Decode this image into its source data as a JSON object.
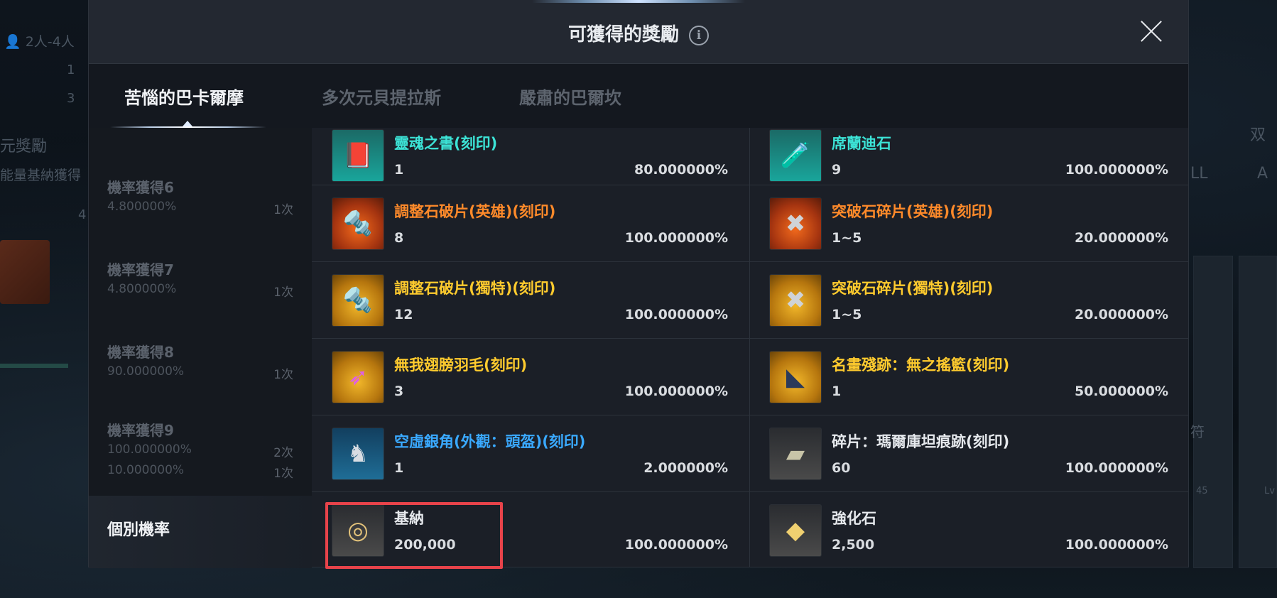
{
  "background": {
    "party_size": "2人-4人",
    "rewards_title": "元獎勵",
    "gain_text": "能量基納獲得",
    "count_a": "1",
    "count_b": "3",
    "count_c": "4",
    "right_text": "双",
    "right_char_a": "LL",
    "right_char_b": "A",
    "right_char_c": "符",
    "level_a": "45",
    "level_b": "Lv"
  },
  "modal": {
    "title": "可獲得的獎勵",
    "info_glyph": "i",
    "tabs": [
      {
        "label": "苦惱的巴卡爾摩",
        "active": true
      },
      {
        "label": "多次元貝提拉斯",
        "active": false
      },
      {
        "label": "嚴肅的巴爾坎",
        "active": false
      }
    ]
  },
  "sidebar": {
    "groups": [
      {
        "title": "機率獲得6",
        "rows": [
          {
            "rate": "4.800000%",
            "count": "1次"
          }
        ]
      },
      {
        "title": "機率獲得7",
        "rows": [
          {
            "rate": "4.800000%",
            "count": "1次"
          }
        ]
      },
      {
        "title": "機率獲得8",
        "rows": [
          {
            "rate": "90.000000%",
            "count": "1次"
          }
        ]
      },
      {
        "title": "機率獲得9",
        "rows": [
          {
            "rate": "100.000000%",
            "count": "2次"
          },
          {
            "rate": "10.000000%",
            "count": "1次"
          }
        ]
      }
    ],
    "active_label": "個別機率"
  },
  "items": [
    {
      "name": "靈魂之書(刻印)",
      "qty": "1",
      "rate": "80.000000%",
      "color": "#3ce3d6",
      "icon": "book-icon"
    },
    {
      "name": "席蘭迪石",
      "qty": "9",
      "rate": "100.000000%",
      "color": "#3ce3d6",
      "icon": "stone-icon"
    },
    {
      "name": "調整石破片(英雄)(刻印)",
      "qty": "8",
      "rate": "100.000000%",
      "color": "#ff8a2a",
      "icon": "shard-icon"
    },
    {
      "name": "突破石碎片(英雄)(刻印)",
      "qty": "1~5",
      "rate": "20.000000%",
      "color": "#ff8a2a",
      "icon": "breakthrough-icon"
    },
    {
      "name": "調整石破片(獨特)(刻印)",
      "qty": "12",
      "rate": "100.000000%",
      "color": "#ffcb2e",
      "icon": "shard-icon"
    },
    {
      "name": "突破石碎片(獨特)(刻印)",
      "qty": "1~5",
      "rate": "20.000000%",
      "color": "#ffcb2e",
      "icon": "breakthrough-icon"
    },
    {
      "name": "無我翅膀羽毛(刻印)",
      "qty": "3",
      "rate": "100.000000%",
      "color": "#ffcb2e",
      "icon": "feather-icon"
    },
    {
      "name": "名畫殘跡：無之搖籃(刻印)",
      "qty": "1",
      "rate": "50.000000%",
      "color": "#ffcb2e",
      "icon": "painting-icon"
    },
    {
      "name": "空虛銀角(外觀：頭盔)(刻印)",
      "qty": "1",
      "rate": "2.000000%",
      "color": "#3aa9ff",
      "icon": "helmet-icon"
    },
    {
      "name": "碎片：瑪爾庫坦痕跡(刻印)",
      "qty": "60",
      "rate": "100.000000%",
      "color": "#e6e9ed",
      "icon": "fragment-icon"
    },
    {
      "name": "基納",
      "qty": "200,000",
      "rate": "100.000000%",
      "color": "#e6e9ed",
      "icon": "coin-icon"
    },
    {
      "name": "強化石",
      "qty": "2,500",
      "rate": "100.000000%",
      "color": "#e6e9ed",
      "icon": "enhance-stone-icon"
    }
  ]
}
